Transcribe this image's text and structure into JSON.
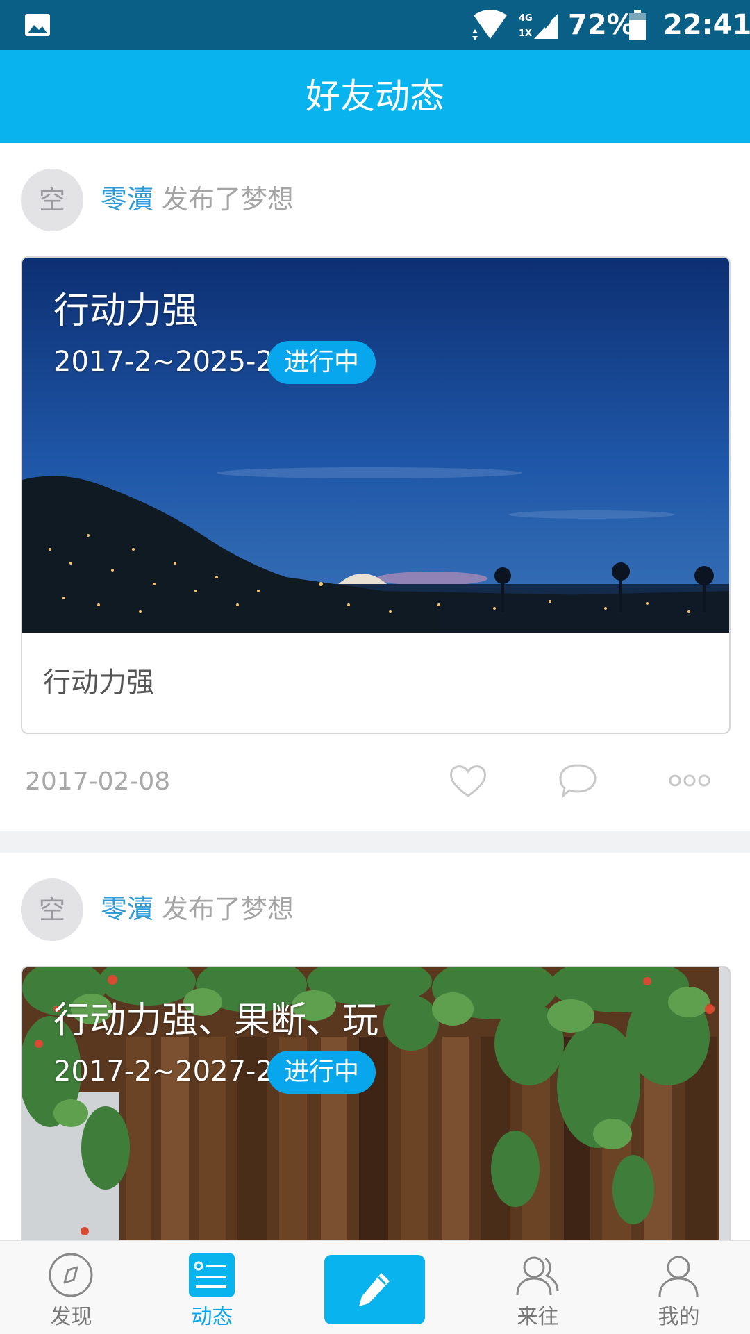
{
  "status_bar": {
    "network_label": "4G",
    "network_sub": "1X",
    "battery": "72%",
    "time": "22:41"
  },
  "header": {
    "title": "好友动态"
  },
  "posts": [
    {
      "avatar_char": "空",
      "author": "零瀆",
      "action": "发布了梦想",
      "dream_title": "行动力强",
      "dates": "2017-2~2025-2",
      "status": "进行中",
      "body": "行动力强",
      "date": "2017-02-08"
    },
    {
      "avatar_char": "空",
      "author": "零瀆",
      "action": "发布了梦想",
      "dream_title": "行动力强、果断、玩",
      "dates": "2017-2~2027-2",
      "status": "进行中"
    }
  ],
  "bottom_nav": {
    "items": [
      {
        "label": "发现",
        "icon": "compass-icon"
      },
      {
        "label": "动态",
        "icon": "feed-icon"
      },
      {
        "label": "",
        "icon": "pencil-icon"
      },
      {
        "label": "来往",
        "icon": "contacts-icon"
      },
      {
        "label": "我的",
        "icon": "profile-icon"
      }
    ],
    "active": "动态"
  },
  "colors": {
    "accent": "#08b3ee",
    "status_bar": "#0a5f86",
    "author_name": "#2f9bd6",
    "badge": "#08a6ec"
  }
}
